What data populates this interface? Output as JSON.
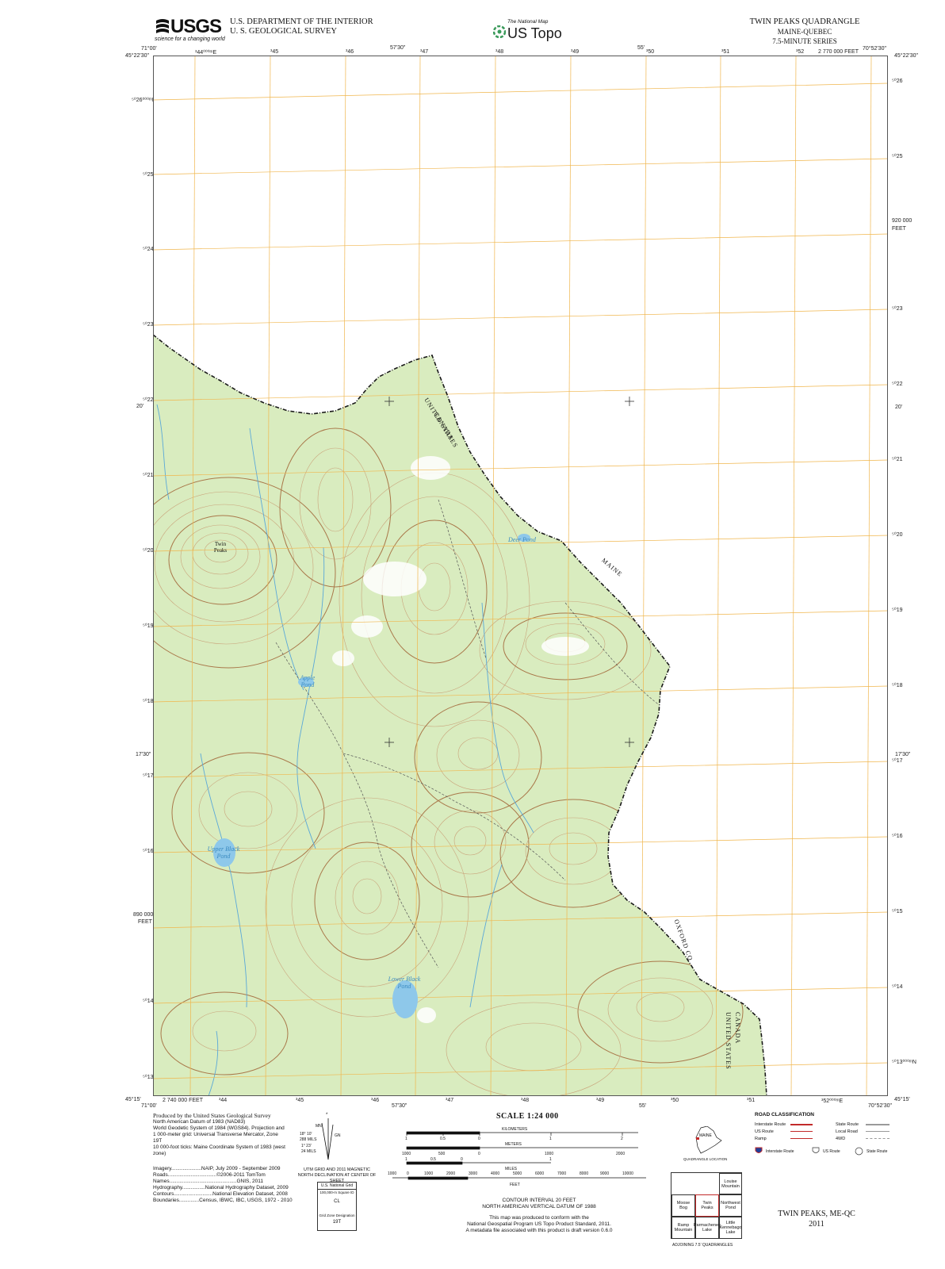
{
  "header": {
    "agency_logo": "USGS",
    "agency_tagline": "science for a changing world",
    "dept_line1": "U.S. DEPARTMENT OF THE INTERIOR",
    "dept_line2": "U. S. GEOLOGICAL SURVEY",
    "national_map_small": "The National Map",
    "national_map_main": "US Topo",
    "quad_title": "TWIN PEAKS QUADRANGLE",
    "quad_state": "MAINE-QUEBEC",
    "quad_series": "7.5-MINUTE SERIES"
  },
  "map": {
    "corner_labels": {
      "top_left_lon": "71°00'",
      "top_left_lat": "45°22'30\"",
      "top_right_lon": "70°52'30\"",
      "top_right_lat": "45°22'30\"",
      "bottom_left_lat": "45°15'",
      "bottom_left_lon": "71°00'",
      "bottom_right_lat": "45°15'",
      "bottom_right_lon": "70°52'30\""
    },
    "top_ticks": [
      "³44⁰⁰⁰ᵐE",
      "³45",
      "³46",
      "57'30\"",
      "³47",
      "³48",
      "³49",
      "55'",
      "³50",
      "³51",
      "³52",
      "2 770 000 FEET"
    ],
    "bottom_ticks": [
      "2 740 000 FEET",
      "³44",
      "³45",
      "³46",
      "57'30\"",
      "³47",
      "³48",
      "³49",
      "55'",
      "³50",
      "³51",
      "³52⁰⁰⁰ᵐE"
    ],
    "left_ticks": [
      "⁵⁰26⁰⁰⁰ᵐN",
      "⁵⁰25",
      "⁵⁰24",
      "⁵⁰23",
      "⁵⁰22",
      "20'",
      "⁵⁰21",
      "⁵⁰20",
      "⁵⁰19",
      "⁵⁰18",
      "17'30\"",
      "⁵⁰17",
      "⁵⁰16",
      "890 000",
      "FEET",
      "⁵⁰14",
      "⁵⁰13"
    ],
    "right_ticks": [
      "⁵⁰26",
      "⁵⁰25",
      "920 000",
      "FEET",
      "⁵⁰23",
      "⁵⁰22",
      "20'",
      "⁵⁰21",
      "⁵⁰20",
      "⁵⁰19",
      "⁵⁰18",
      "17'30\"",
      "⁵⁰17",
      "⁵⁰16",
      "⁵⁰15",
      "⁵⁰14",
      "⁵⁰13⁰⁰⁰ᵐN"
    ],
    "features": {
      "twin_peaks": "Twin Peaks",
      "deer_pond": "Deer Pond",
      "apple_pond": "Apple Pond",
      "upper_black_pond": "Upper Black Pond",
      "lower_black_pond": "Lower Black Pond",
      "canada": "CANADA",
      "united_states": "UNITED STATES",
      "maine": "MAINE",
      "oxford_co": "OXFORD CO",
      "canada2": "CANADA",
      "united_states2": "UNITED STATES"
    },
    "colors": {
      "woodland": "#d9ecbf",
      "contour": "#c9a37a",
      "contour_index": "#a9784a",
      "grid": "#f0b64d",
      "water": "#8ec8ea",
      "border": "#1a1a1a"
    }
  },
  "footer": {
    "produced_by": "Produced by the United States Geological Survey",
    "datum1": "North American Datum of 1983 (NAD83)",
    "datum2": "World Geodetic System of 1984 (WGS84). Projection and",
    "datum3": "1 000-meter grid: Universal Transverse Mercator, Zone 19T",
    "datum4": "10 000-foot ticks: Maine Coordinate System of 1983 (west",
    "datum5": "zone)",
    "credits": [
      "Imagery.....................NAIP, July 2009 - September 2009",
      "Roads..................................©2006-2011 TomTom",
      "Names...............................................GNIS, 2011",
      "Hydrography................National Hydrography Dataset, 2009",
      "Contours...........................National Elevation Dataset, 2008",
      "Boundaries..............Census, IBWC, IBC, USGS, 1972 - 2010"
    ],
    "declination_text": "UTM GRID AND 2011 MAGNETIC NORTH DECLINATION AT CENTER OF SHEET",
    "decl_values": [
      "18° 10'",
      "288 MILS",
      "1° 23'",
      "24 MILS"
    ],
    "decl_labels": [
      "MN",
      "GN",
      "*"
    ],
    "national_grid": "U.S. National Grid",
    "national_grid_sub": "100,000-m Square ID",
    "national_grid_id": "CL",
    "grid_zone": "Grid Zone Designation",
    "grid_zone_id": "19T",
    "scale_title": "SCALE 1:24 000",
    "km_label": "KILOMETERS",
    "m_label": "METERS",
    "mi_label": "MILES",
    "ft_label": "FEET",
    "km_ticks": [
      "1",
      "0.5",
      "0",
      "1",
      "2"
    ],
    "m_ticks": [
      "1000",
      "500",
      "0",
      "1000",
      "2000"
    ],
    "mi_ticks": [
      "1",
      "0.5",
      "0",
      "1"
    ],
    "ft_ticks": [
      "1000",
      "0",
      "1000",
      "2000",
      "3000",
      "4000",
      "5000",
      "6000",
      "7000",
      "8000",
      "9000",
      "10000"
    ],
    "contour_interval": "CONTOUR INTERVAL 20 FEET",
    "vertical_datum": "NORTH AMERICAN VERTICAL DATUM OF 1988",
    "conform1": "This map was produced to conform with the",
    "conform2": "National Geospatial Program US Topo Product Standard, 2011.",
    "conform3": "A metadata file associated with this product is draft version 0.6.0",
    "location_state": "MAINE",
    "location_caption": "QUADRANGLE LOCATION",
    "adjoining": [
      [
        "",
        "",
        "Louise Mountain"
      ],
      [
        "Moose Bog",
        "Twin Peaks",
        "Northwest Pond"
      ],
      [
        "Ramp Mountain",
        "Parmachenee Lake",
        "Little Kennebago Lake"
      ]
    ],
    "adjoining_caption": "ADJOINING 7.5' QUADRANGLES",
    "road_title": "ROAD CLASSIFICATION",
    "road_items": [
      {
        "label": "Interstate Route",
        "color": "#c22a2a"
      },
      {
        "label": "State Route",
        "color": "#9a9a9a"
      },
      {
        "label": "US Route",
        "color": "#c22a2a"
      },
      {
        "label": "Local Road",
        "color": "#9a9a9a"
      },
      {
        "label": "Ramp",
        "color": "#c22a2a"
      },
      {
        "label": "4WD",
        "color": "#9a9a9a"
      }
    ],
    "shield_labels": [
      "Interstate Route",
      "US Route",
      "State Route"
    ],
    "bottom_name": "TWIN PEAKS, ME-QC",
    "bottom_year": "2011"
  }
}
